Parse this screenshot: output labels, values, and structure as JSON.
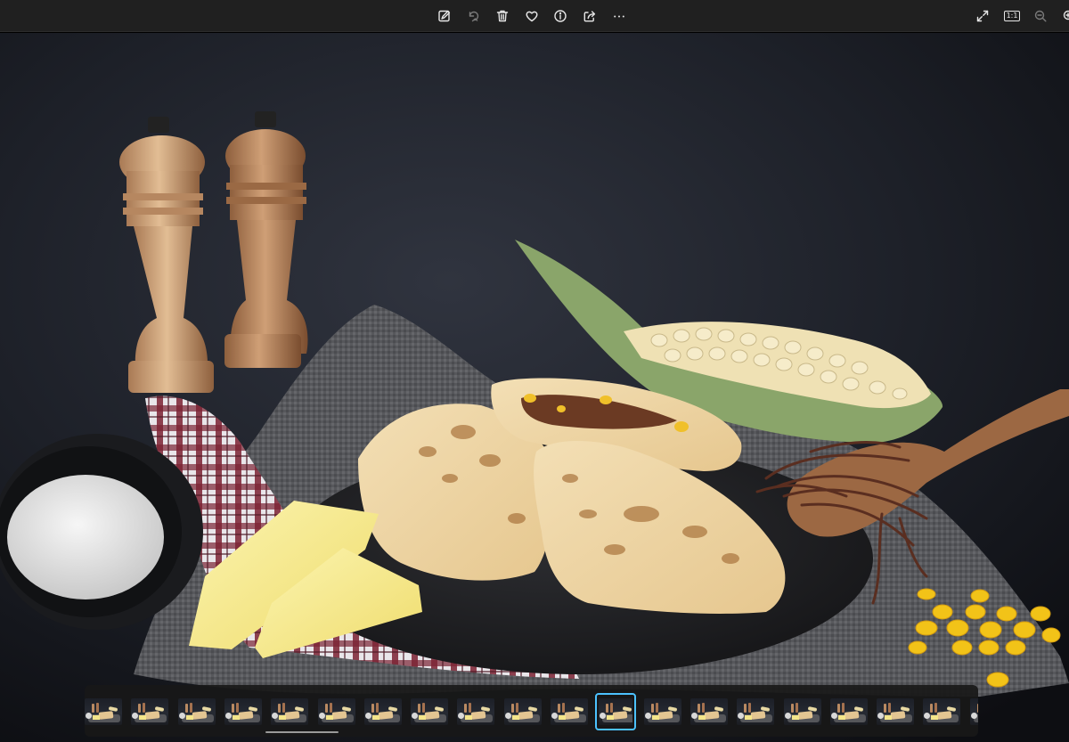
{
  "toolbar": {
    "center_buttons": [
      {
        "name": "edit-image-button",
        "icon": "edit-image-icon"
      },
      {
        "name": "rotate-button",
        "icon": "rotate-icon"
      },
      {
        "name": "delete-button",
        "icon": "trash-icon"
      },
      {
        "name": "favorite-button",
        "icon": "heart-icon"
      },
      {
        "name": "file-info-button",
        "icon": "info-icon"
      },
      {
        "name": "share-button",
        "icon": "share-icon"
      },
      {
        "name": "more-options-button",
        "icon": "ellipsis-icon"
      }
    ],
    "right_buttons": [
      {
        "name": "full-screen-button",
        "icon": "expand-icon"
      },
      {
        "name": "actual-size-button",
        "icon": "ratio-1-1-icon",
        "label": "1:1"
      },
      {
        "name": "zoom-out-button",
        "icon": "zoom-out-icon"
      },
      {
        "name": "zoom-in-button",
        "icon": "zoom-in-icon"
      }
    ]
  },
  "photo": {
    "subject": "food-photo"
  },
  "filmstrip": {
    "thumbnail_count": 20,
    "selected_index": 11,
    "accent_color": "#4cc2ff"
  },
  "colors": {
    "toolbar_bg": "#202020",
    "icon": "#e6e6e6",
    "accent": "#4cc2ff"
  }
}
